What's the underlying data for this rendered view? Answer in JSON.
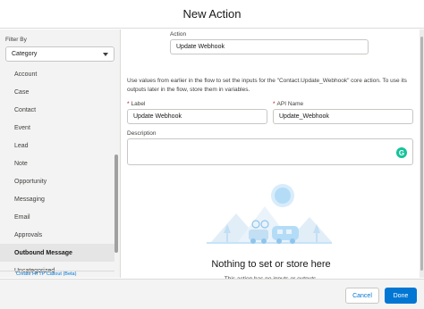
{
  "header": {
    "title": "New Action"
  },
  "filter": {
    "label": "Filter By",
    "selected": "Category",
    "categories": [
      "Account",
      "Case",
      "Contact",
      "Event",
      "Lead",
      "Note",
      "Opportunity",
      "Messaging",
      "Email",
      "Approvals",
      "Outbound Message",
      "Uncategorized"
    ],
    "active": "Outbound Message",
    "bottom_link": "Create HTTP Callout (Beta)"
  },
  "action": {
    "label": "Action",
    "value": "Update Webhook"
  },
  "description_text": "Use values from earlier in the flow to set the inputs for the \"Contact.Update_Webhook\" core action. To use its outputs later in the flow, store them in variables.",
  "fields": {
    "label_label": "Label",
    "label_value": "Update Webhook",
    "api_label": "API Name",
    "api_value": "Update_Webhook",
    "description_label": "Description",
    "required_mark": "*"
  },
  "empty_state": {
    "title": "Nothing to set or store here",
    "subtitle": "This action has no inputs or outputs."
  },
  "footer": {
    "cancel_label": "Cancel",
    "done_label": "Done"
  },
  "colors": {
    "brand": "#0176d3",
    "grammarly": "#15c39a"
  }
}
